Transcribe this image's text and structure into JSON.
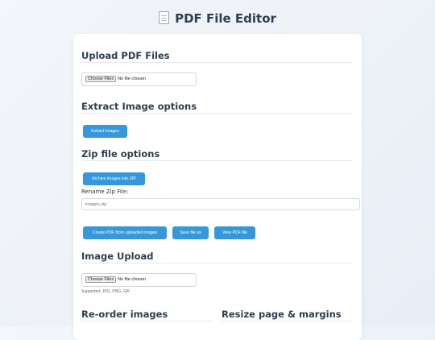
{
  "page": {
    "title": "PDF File Editor",
    "title_icon": "document-icon"
  },
  "upload_pdf": {
    "heading": "Upload PDF Files",
    "choose_label": "Choose Files",
    "status": "No file chosen"
  },
  "extract": {
    "heading": "Extract Image options",
    "button": "Extract Images"
  },
  "zip": {
    "heading": "Zip file options",
    "archive_button": "Archive images into ZIP",
    "rename_label": "Rename Zip File:",
    "rename_value": "images.zip"
  },
  "actions": {
    "create_pdf": "Create PDF from uploaded images",
    "save_as": "Save file as",
    "view_pdf": "View PDF file"
  },
  "image_upload": {
    "heading": "Image Upload",
    "choose_label": "Choose Files",
    "status": "No file chosen",
    "supported": "Supported: JPG, PNG, GIF"
  },
  "reorder": {
    "heading": "Re-order images"
  },
  "resize": {
    "heading": "Resize page & margins"
  },
  "colors": {
    "accent": "#3498db",
    "heading": "#2c3e50",
    "background": "#eef2f7"
  }
}
